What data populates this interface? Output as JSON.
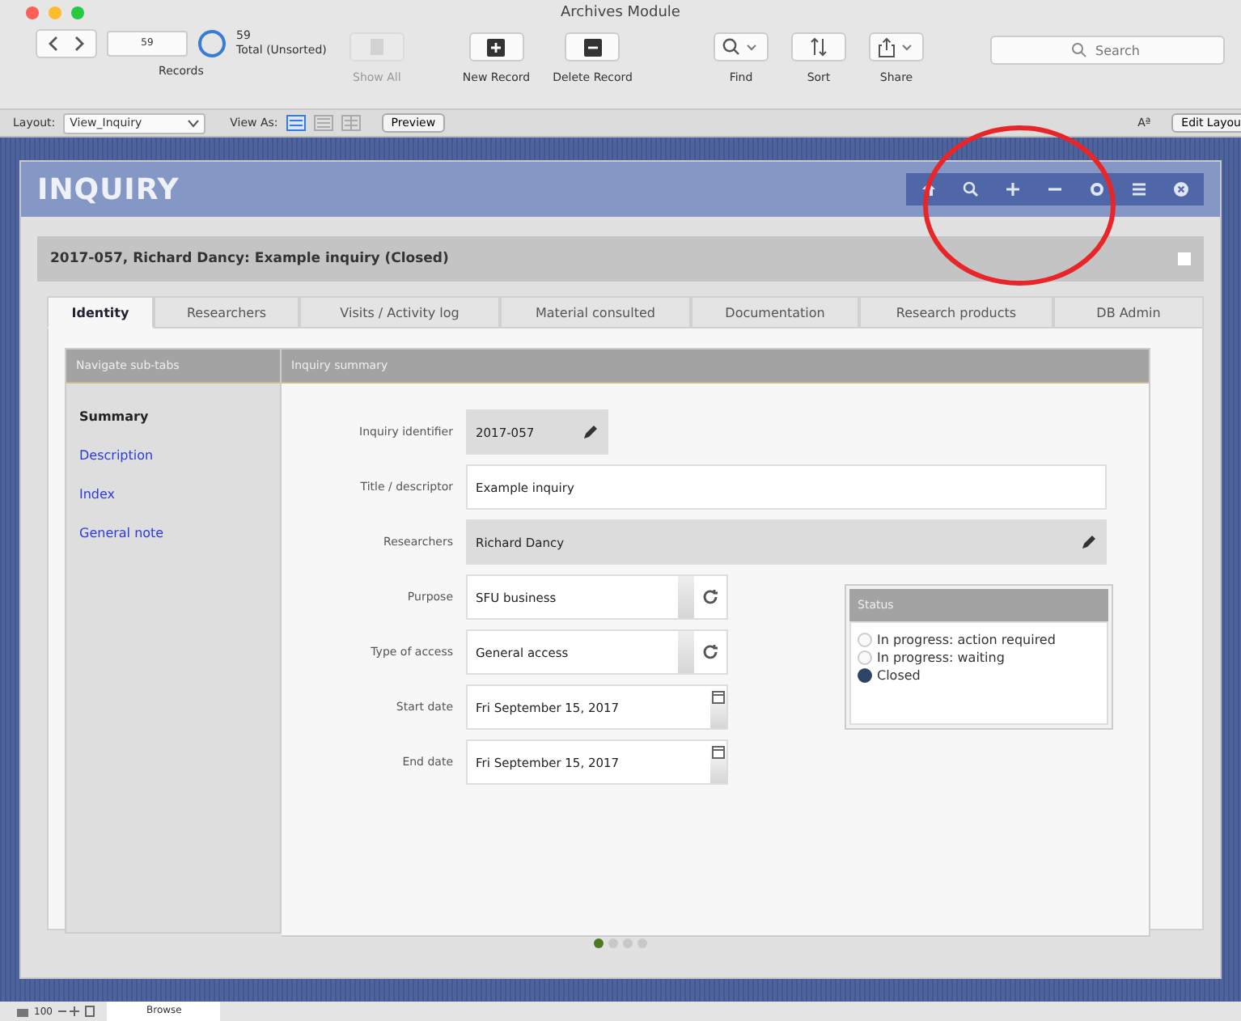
{
  "window": {
    "title": "Archives Module"
  },
  "toolbar": {
    "record_field": "59",
    "found_count": "59",
    "found_label": "Total (Unsorted)",
    "records_label": "Records",
    "buttons": [
      {
        "kind": "show-all",
        "label": "Show All",
        "disabled": true
      },
      {
        "kind": "new",
        "label": "New Record",
        "disabled": false
      },
      {
        "kind": "delete",
        "label": "Delete Record",
        "disabled": false
      },
      {
        "kind": "find",
        "label": "Find",
        "disabled": false
      },
      {
        "kind": "sort",
        "label": "Sort",
        "disabled": false
      },
      {
        "kind": "share",
        "label": "Share",
        "disabled": false
      }
    ],
    "search": {
      "placeholder": "Search"
    }
  },
  "layout_bar": {
    "layout_label": "Layout:",
    "layout_value": "View_Inquiry",
    "view_as_label": "View As:",
    "views": [
      {
        "kind": "form",
        "selected": true
      },
      {
        "kind": "list",
        "selected": false
      },
      {
        "kind": "table",
        "selected": false
      }
    ],
    "preview": "Preview",
    "text_size": "Aª",
    "edit_layout": "Edit Layou"
  },
  "header": {
    "title": "INQUIRY"
  },
  "record_title": "2017-057, Richard Dancy: Example inquiry (Closed)",
  "record_flag": {
    "checked": false
  },
  "tabs": [
    {
      "label": "Identity",
      "selected": true
    },
    {
      "label": "Researchers",
      "selected": false
    },
    {
      "label": "Visits / Activity log",
      "selected": false
    },
    {
      "label": "Material consulted",
      "selected": false
    },
    {
      "label": "Documentation",
      "selected": false
    },
    {
      "label": "Research products",
      "selected": false
    },
    {
      "label": "DB Admin",
      "selected": false
    }
  ],
  "subnav": {
    "title": "Navigate sub-tabs",
    "items": [
      {
        "label": "Summary",
        "selected": true
      },
      {
        "label": "Description",
        "selected": false
      },
      {
        "label": "Index",
        "selected": false
      },
      {
        "label": "General note",
        "selected": false
      }
    ]
  },
  "summary": {
    "title": "Inquiry summary",
    "fields": [
      {
        "kind": "locked",
        "label": "Inquiry identifier",
        "value": "2017-057"
      },
      {
        "kind": "text",
        "label": "Title / descriptor",
        "value": "Example inquiry"
      },
      {
        "kind": "locked-wide",
        "label": "Researchers",
        "value": "Richard Dancy"
      },
      {
        "kind": "dropdown",
        "label": "Purpose",
        "value": "SFU business"
      },
      {
        "kind": "dropdown",
        "label": "Type of access",
        "value": "General access"
      },
      {
        "kind": "date",
        "label": "Start date",
        "value": "Fri September 15, 2017"
      },
      {
        "kind": "date",
        "label": "End date",
        "value": "Fri September 15, 2017"
      }
    ]
  },
  "status": {
    "title": "Status",
    "options": [
      {
        "label": "In progress: action required",
        "checked": false
      },
      {
        "label": "In progress: waiting",
        "checked": false
      },
      {
        "label": "Closed",
        "checked": true
      }
    ]
  },
  "pages": [
    {
      "selected": true
    },
    {
      "selected": false
    },
    {
      "selected": false
    },
    {
      "selected": false
    }
  ],
  "status_bar": {
    "zoom": "100",
    "mode": "Browse"
  }
}
